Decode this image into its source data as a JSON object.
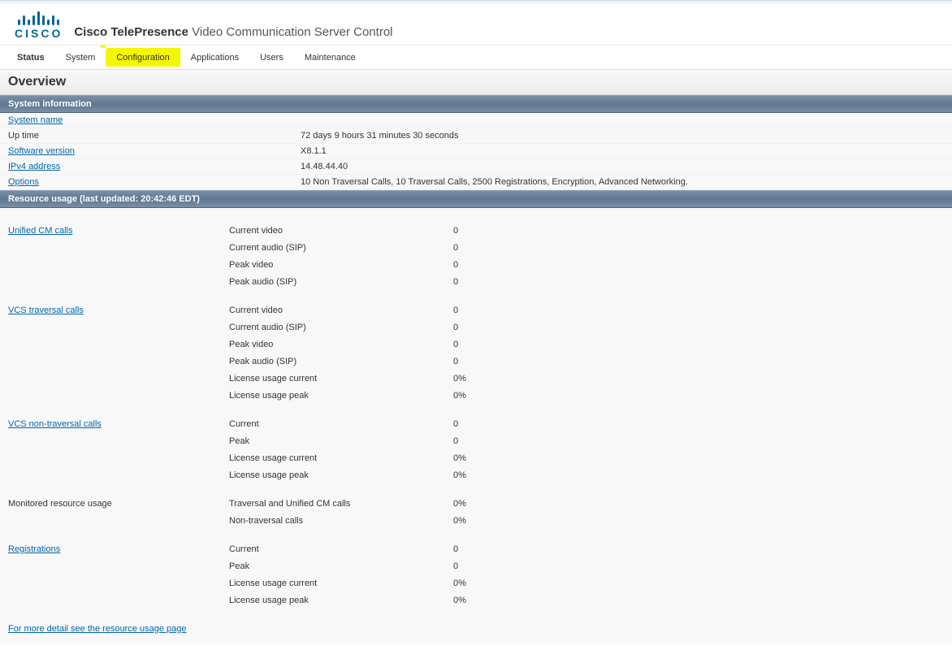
{
  "brand": {
    "name": "CISCO"
  },
  "product": {
    "bold": "Cisco TelePresence",
    "rest": " Video Communication Server Control"
  },
  "nav": {
    "tabs": [
      {
        "label": "Status",
        "active": true,
        "highlight": false
      },
      {
        "label": "System",
        "active": false,
        "highlight": false
      },
      {
        "label": "Configuration",
        "active": false,
        "highlight": true
      },
      {
        "label": "Applications",
        "active": false,
        "highlight": false
      },
      {
        "label": "Users",
        "active": false,
        "highlight": false
      },
      {
        "label": "Maintenance",
        "active": false,
        "highlight": false
      }
    ]
  },
  "page_title": "Overview",
  "section_sysinfo_title": "System information",
  "sysinfo": {
    "system_name": {
      "label": "System name",
      "value": ""
    },
    "uptime": {
      "label": "Up time",
      "value": "72 days 9 hours 31 minutes 30 seconds"
    },
    "software": {
      "label": "Software version",
      "value": "X8.1.1"
    },
    "ipv4": {
      "label": "IPv4 address",
      "value": "14.48.44.40"
    },
    "options": {
      "label": "Options",
      "value": "10 Non Traversal Calls, 10 Traversal Calls, 2500 Registrations, Encryption, Advanced Networking."
    }
  },
  "section_resource_title": "Resource usage (last updated: 20:42:46 EDT)",
  "resource": {
    "ucm": {
      "title": "Unified CM calls",
      "rows": [
        {
          "label": "Current video",
          "value": "0"
        },
        {
          "label": "Current audio (SIP)",
          "value": "0"
        },
        {
          "label": "Peak video",
          "value": "0"
        },
        {
          "label": "Peak audio (SIP)",
          "value": "0"
        }
      ]
    },
    "vcs_trav": {
      "title": "VCS traversal calls",
      "rows": [
        {
          "label": "Current video",
          "value": "0"
        },
        {
          "label": "Current audio (SIP)",
          "value": "0"
        },
        {
          "label": "Peak video",
          "value": "0"
        },
        {
          "label": "Peak audio (SIP)",
          "value": "0"
        },
        {
          "label": "License usage current",
          "value": "0%"
        },
        {
          "label": "License usage peak",
          "value": "0%"
        }
      ]
    },
    "vcs_nontrav": {
      "title": "VCS non-traversal calls",
      "rows": [
        {
          "label": "Current",
          "value": "0"
        },
        {
          "label": "Peak",
          "value": "0"
        },
        {
          "label": "License usage current",
          "value": "0%"
        },
        {
          "label": "License usage peak",
          "value": "0%"
        }
      ]
    },
    "monitored": {
      "title": "Monitored resource usage",
      "rows": [
        {
          "label": "Traversal and Unified CM calls",
          "value": "0%"
        },
        {
          "label": "Non-traversal calls",
          "value": "0%"
        }
      ]
    },
    "registrations": {
      "title": "Registrations",
      "rows": [
        {
          "label": "Current",
          "value": "0"
        },
        {
          "label": "Peak",
          "value": "0"
        },
        {
          "label": "License usage current",
          "value": "0%"
        },
        {
          "label": "License usage peak",
          "value": "0%"
        }
      ]
    }
  },
  "footer_link": "For more detail see the resource usage page"
}
